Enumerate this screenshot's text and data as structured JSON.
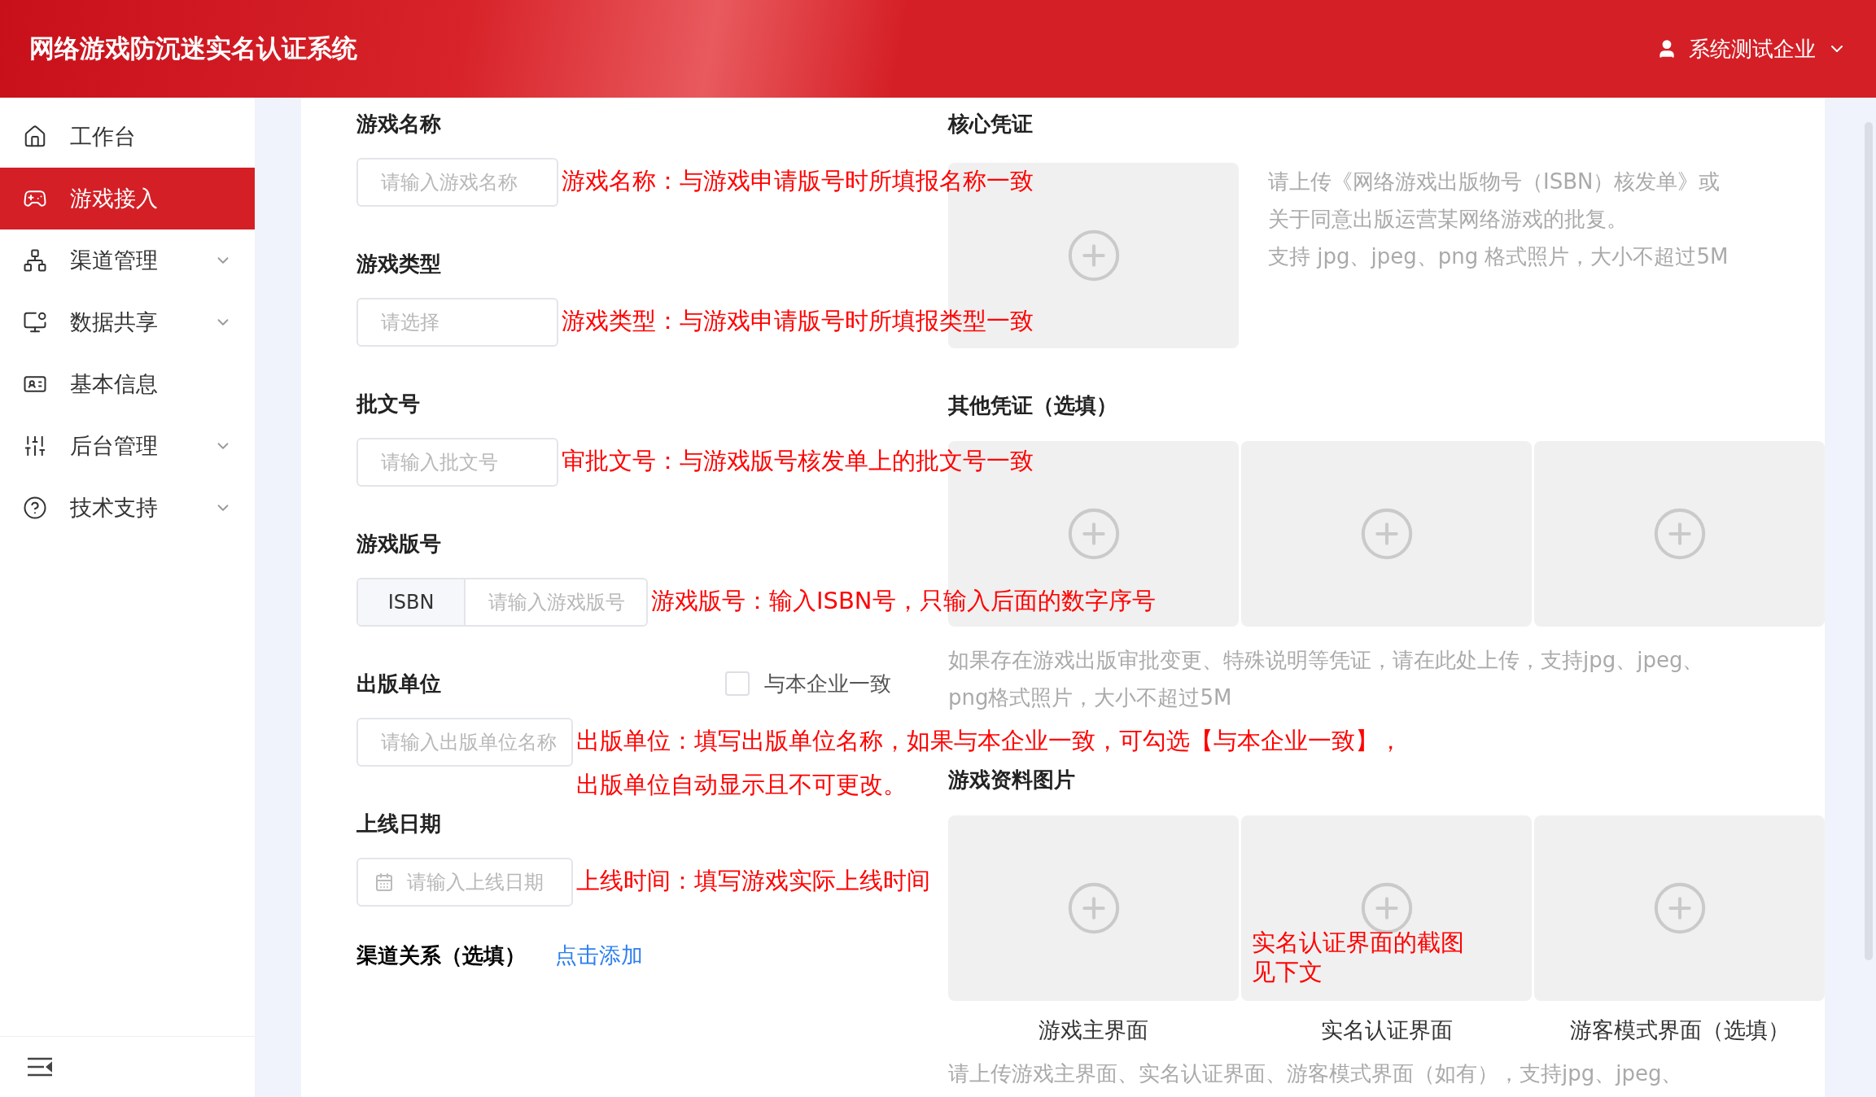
{
  "header": {
    "title": "网络游戏防沉迷实名认证系统",
    "user": "系统测试企业"
  },
  "sidebar": {
    "items": [
      {
        "label": "工作台",
        "selected": false,
        "expandable": false
      },
      {
        "label": "游戏接入",
        "selected": true,
        "expandable": false
      },
      {
        "label": "渠道管理",
        "selected": false,
        "expandable": true
      },
      {
        "label": "数据共享",
        "selected": false,
        "expandable": true
      },
      {
        "label": "基本信息",
        "selected": false,
        "expandable": false
      },
      {
        "label": "后台管理",
        "selected": false,
        "expandable": true
      },
      {
        "label": "技术支持",
        "selected": false,
        "expandable": true
      }
    ]
  },
  "form": {
    "fields": [
      {
        "kind": "text",
        "label": "游戏名称",
        "placeholder": "请输入游戏名称",
        "note": [
          "游戏名称：与游戏申请版号时所填报名称一致"
        ]
      },
      {
        "kind": "select",
        "label": "游戏类型",
        "placeholder": "请选择",
        "note": [
          "游戏类型：与游戏申请版号时所填报类型一致"
        ]
      },
      {
        "kind": "text",
        "label": "批文号",
        "placeholder": "请输入批文号",
        "note": [
          "审批文号：与游戏版号核发单上的批文号一致"
        ]
      },
      {
        "kind": "addon",
        "label": "游戏版号",
        "addon": "ISBN",
        "placeholder": "请输入游戏版号",
        "note": [
          "游戏版号：输入ISBN号，只输入后面的数字序号"
        ]
      },
      {
        "kind": "text",
        "label": "出版单位",
        "placeholder": "请输入出版单位名称",
        "checkbox": {
          "label": "与本企业一致",
          "checked": false
        },
        "note": [
          "出版单位：填写出版单位名称，如果与本企业一致，可勾选【与本企业一致】，",
          "出版单位自动显示且不可更改。"
        ]
      },
      {
        "kind": "date",
        "label": "上线日期",
        "placeholder": "请输入上线日期",
        "note": [
          "上线时间：填写游戏实际上线时间"
        ]
      }
    ],
    "channel": {
      "label": "渠道关系（选填）",
      "link": "点击添加"
    }
  },
  "uploads": {
    "core": {
      "title": "核心凭证",
      "help": [
        "请上传《网络游戏出版物号（ISBN）核发单》或关于同意出版运营某网络游戏的批复。",
        "支持 jpg、jpeg、png 格式照片，大小不超过5M"
      ]
    },
    "other": {
      "title": "其他凭证（选填）",
      "help": "如果存在游戏出版审批变更、特殊说明等凭证，请在此处上传，支持jpg、jpeg、png格式照片，大小不超过5M"
    },
    "material": {
      "title": "游戏资料图片",
      "captions": [
        "游戏主界面",
        "实名认证界面",
        "游客模式界面（选填）"
      ],
      "note": [
        "实名认证界面的截图",
        "见下文"
      ],
      "help": "请上传游戏主界面、实名认证界面、游客模式界面（如有），支持jpg、jpeg、"
    }
  }
}
